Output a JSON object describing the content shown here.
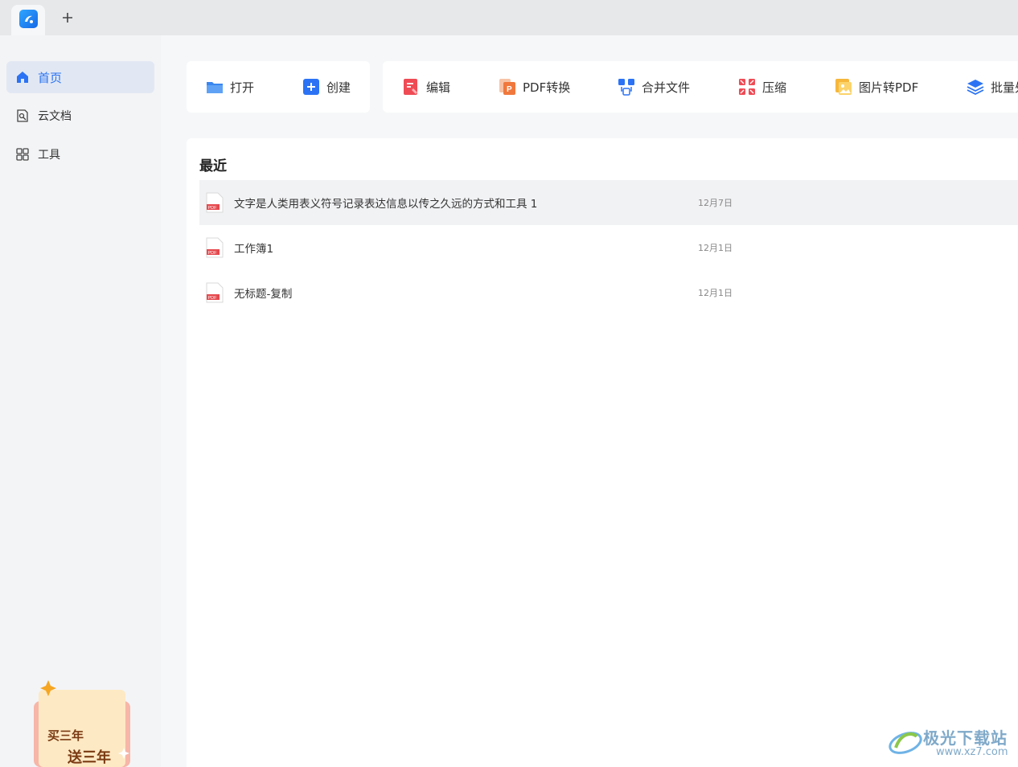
{
  "tabs": {
    "add_label": "+"
  },
  "sidebar": {
    "items": [
      {
        "label": "首页",
        "icon": "home-icon",
        "active": true
      },
      {
        "label": "云文档",
        "icon": "cloud-doc-icon",
        "active": false
      },
      {
        "label": "工具",
        "icon": "grid-tools-icon",
        "active": false
      }
    ],
    "promo": {
      "line1": "买三年",
      "line2": "送三年"
    }
  },
  "toolbar": {
    "open_label": "打开",
    "create_label": "创建",
    "edit_label": "编辑",
    "pdf_convert_label": "PDF转换",
    "merge_label": "合并文件",
    "compress_label": "压缩",
    "image_to_pdf_label": "图片转PDF",
    "batch_label": "批量处"
  },
  "recent": {
    "title": "最近",
    "files": [
      {
        "name": "文字是人类用表义符号记录表达信息以传之久远的方式和工具 1",
        "date": "12月7日"
      },
      {
        "name": "工作簿1",
        "date": "12月1日"
      },
      {
        "name": "无标题-复制",
        "date": "12月1日"
      }
    ]
  },
  "watermark": {
    "text": "极光下载站",
    "url": "www.xz7.com"
  },
  "colors": {
    "accent": "#2b73f4",
    "sidebar_bg": "#f3f4f6",
    "active_item_bg": "#e2e8f3",
    "pdf_red": "#e5484d"
  }
}
